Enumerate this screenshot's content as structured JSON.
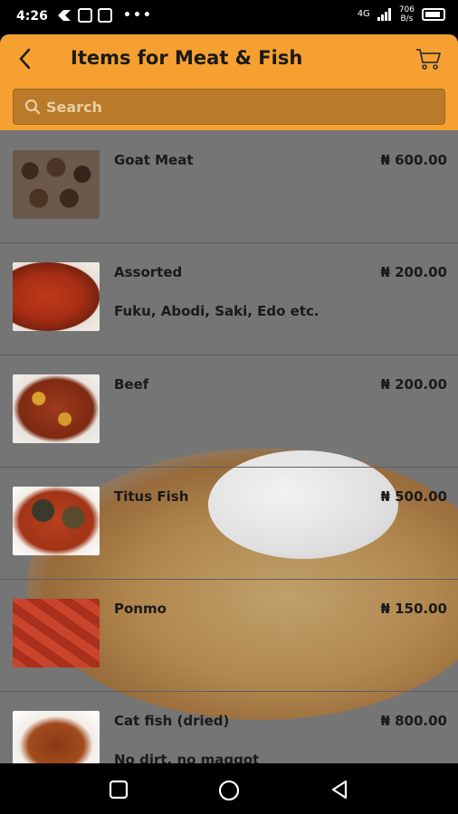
{
  "status_bar": {
    "time": "4:26",
    "signal": "4G",
    "speed_value": "706",
    "speed_unit": "B/s"
  },
  "header": {
    "title": "Items for Meat & Fish",
    "back_icon": "chevron-left-icon",
    "cart_icon": "cart-icon"
  },
  "search": {
    "placeholder": "Search",
    "icon": "search-icon"
  },
  "items": [
    {
      "name": "Goat Meat",
      "price": "₦ 600.00",
      "description": ""
    },
    {
      "name": "Assorted",
      "price": "₦ 200.00",
      "description": "Fuku, Abodi, Saki, Edo etc."
    },
    {
      "name": "Beef",
      "price": "₦ 200.00",
      "description": ""
    },
    {
      "name": "Titus Fish",
      "price": "₦ 500.00",
      "description": ""
    },
    {
      "name": "Ponmo",
      "price": "₦ 150.00",
      "description": ""
    },
    {
      "name": "Cat fish (dried)",
      "price": "₦ 800.00",
      "description": "No dirt, no maggot"
    }
  ],
  "colors": {
    "header": "#f5a030",
    "search_bg": "#b97a2a",
    "list_bg": "#757575"
  }
}
